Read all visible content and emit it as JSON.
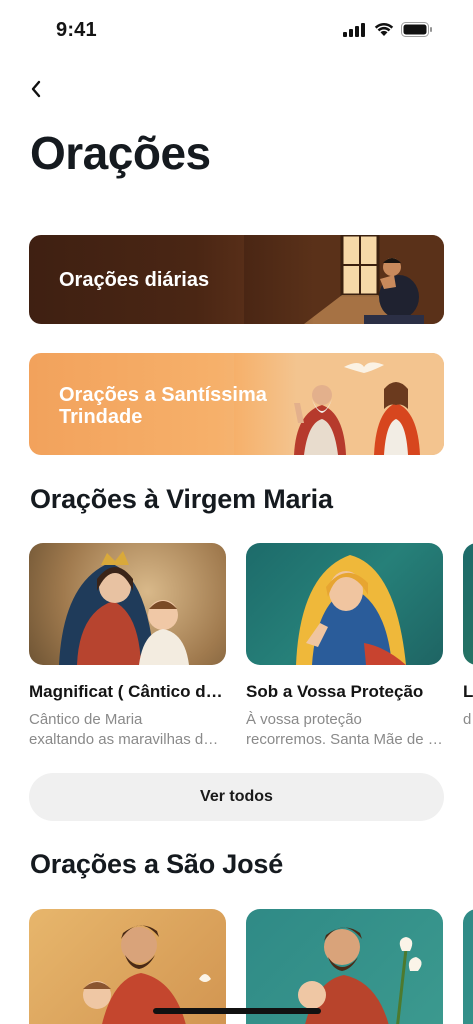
{
  "status_bar": {
    "time": "9:41",
    "icons": [
      "signal-icon",
      "wifi-icon",
      "battery-icon"
    ]
  },
  "header": {
    "back_icon": "chevron-left-icon",
    "title": "Orações"
  },
  "banners": [
    {
      "label": "Orações diárias"
    },
    {
      "label": "Orações a  Santíssima Trindade"
    }
  ],
  "sections": {
    "virgem_maria": {
      "title": "Orações à Virgem Maria",
      "cards": [
        {
          "title": "Magnificat ( Cântico de Maria)",
          "desc_line1": "Cântico de Maria",
          "desc_line2": "exaltando as maravilhas de Deus"
        },
        {
          "title": "Sob a Vossa Proteção",
          "desc_line1": "À vossa proteção",
          "desc_line2": "recorremos. Santa Mãe de Deus"
        },
        {
          "title": "L",
          "desc_line1": "d",
          "desc_line2": ""
        }
      ],
      "see_all": "Ver todos"
    },
    "sao_jose": {
      "title": "Orações a São José"
    }
  },
  "colors": {
    "accent_dark": "#3f2012",
    "accent_orange": "#f2a25c",
    "button_bg": "#f0f0f0",
    "muted_text": "#8a8a8a"
  }
}
